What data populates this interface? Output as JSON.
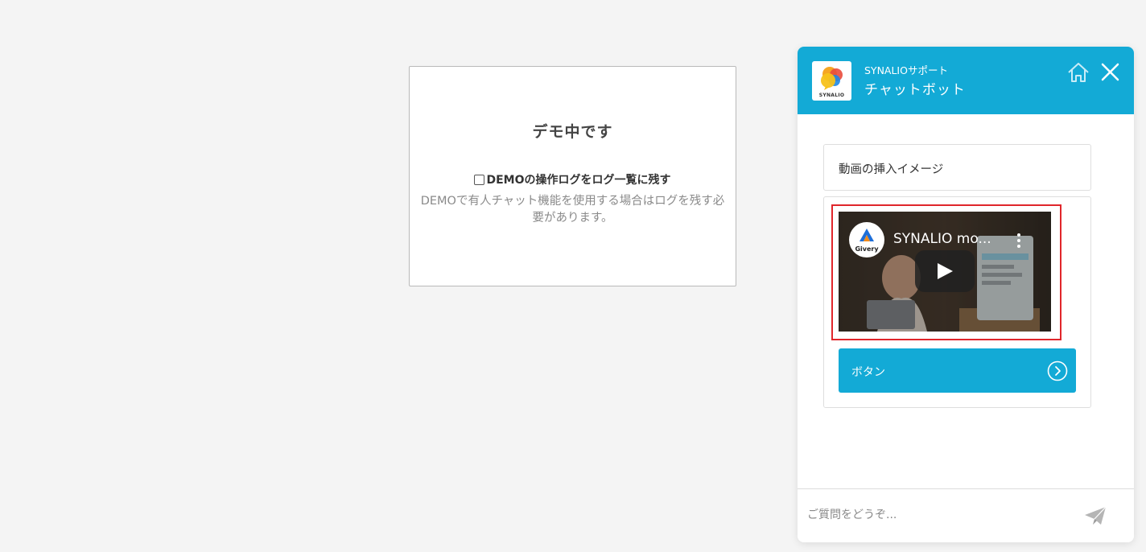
{
  "demo": {
    "title": "デモ中です",
    "checkbox_label": "DEMOの操作ログをログ一覧に残す",
    "checkbox_checked": false,
    "note": "DEMOで有人チャット機能を使用する場合はログを残す必要があります。"
  },
  "chat": {
    "subtitle": "SYNALIOサポート",
    "title": "チャットボット",
    "logo_text": "SYNALIO",
    "home_icon": "home-icon",
    "close_icon": "close-icon",
    "messages": [
      {
        "type": "text",
        "text": "動画の挿入イメージ"
      },
      {
        "type": "video",
        "video_title": "SYNALIO mo...",
        "channel": "Givery",
        "button_label": "ボタン",
        "button_icon": "chevron-right-circle-icon"
      }
    ],
    "input_placeholder": "ご質問をどうぞ...",
    "send_icon": "paper-plane-icon"
  },
  "colors": {
    "accent": "#13aad6",
    "highlight_border": "#e0262b",
    "background": "#f4f4f4"
  }
}
